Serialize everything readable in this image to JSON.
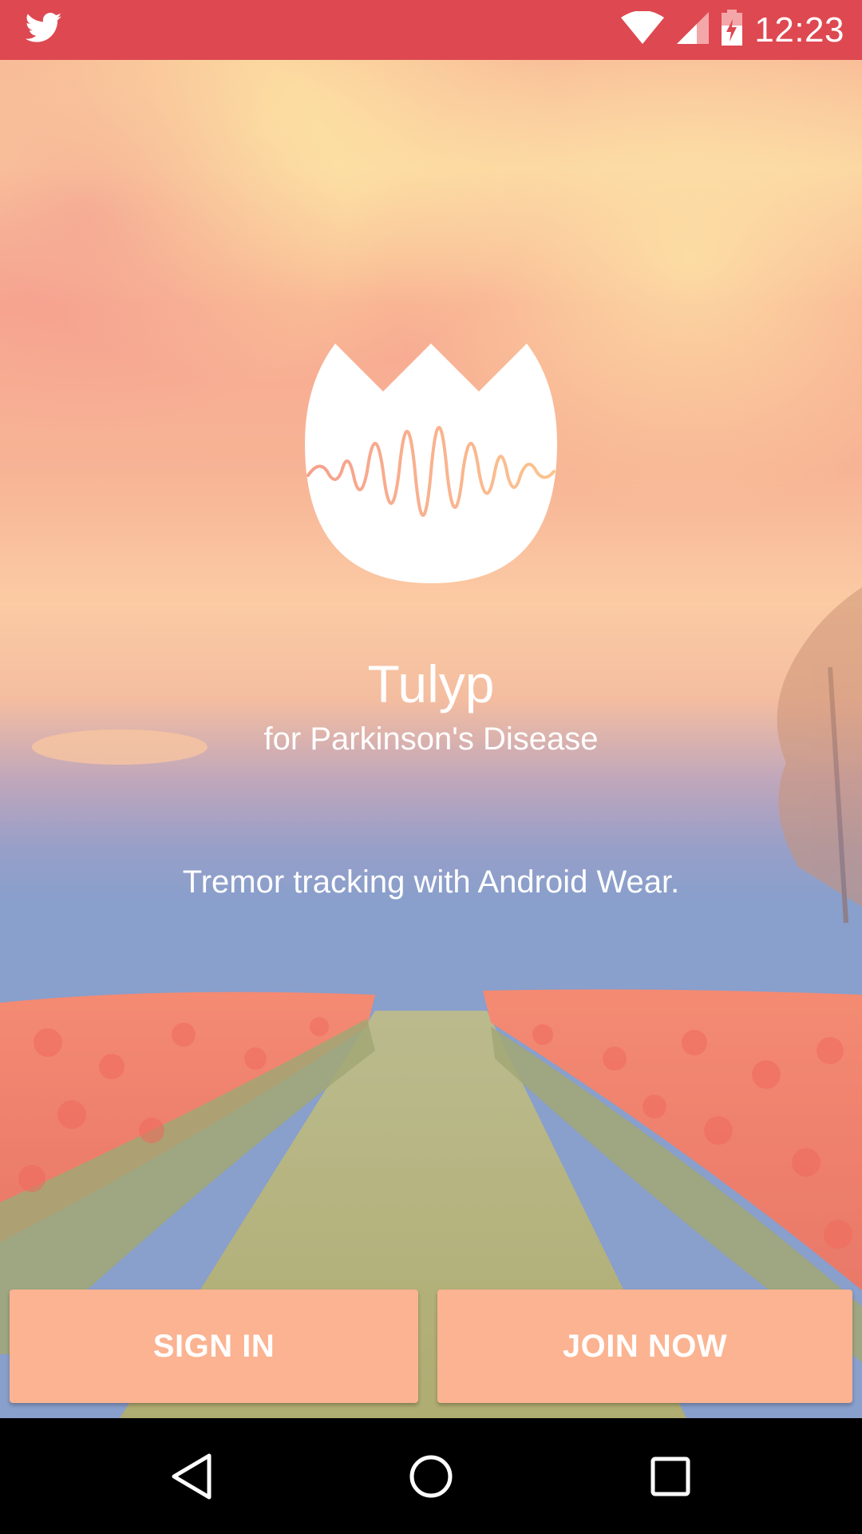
{
  "status_bar": {
    "time": "12:23",
    "color": "#de4850",
    "icons": [
      "twitter-icon",
      "wifi-icon",
      "cell-signal-icon",
      "battery-charging-icon"
    ]
  },
  "app": {
    "title": "Tulyp",
    "subtitle": "for Parkinson's Disease",
    "tagline": "Tremor tracking with Android Wear."
  },
  "buttons": {
    "sign_in": "SIGN IN",
    "join_now": "JOIN NOW",
    "color": "#fbb391"
  },
  "nav_bar": {
    "icons": [
      "back-icon",
      "home-icon",
      "recents-icon"
    ]
  }
}
